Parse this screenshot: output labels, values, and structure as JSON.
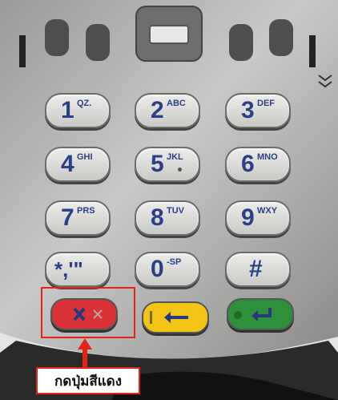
{
  "keys": [
    {
      "digit": "1",
      "sub": "QZ."
    },
    {
      "digit": "2",
      "sub": "ABC"
    },
    {
      "digit": "3",
      "sub": "DEF"
    },
    {
      "digit": "4",
      "sub": "GHI"
    },
    {
      "digit": "5",
      "sub": "JKL"
    },
    {
      "digit": "6",
      "sub": "MNO"
    },
    {
      "digit": "7",
      "sub": "PRS"
    },
    {
      "digit": "8",
      "sub": "TUV"
    },
    {
      "digit": "9",
      "sub": "WXY"
    },
    {
      "digit": "*,'\"",
      "sub": ""
    },
    {
      "digit": "0",
      "sub": "-SP"
    },
    {
      "digit": "#",
      "sub": ""
    }
  ],
  "function_keys": {
    "cancel": {
      "color": "#d9333a",
      "icon": "cancel-x-icon"
    },
    "clear": {
      "color": "#f2c418",
      "icon": "backspace-arrow-icon"
    },
    "enter": {
      "color": "#2f8f3a",
      "icon": "enter-arrow-icon"
    }
  },
  "callout": {
    "label": "กดปุ่มสีแดง",
    "color": "#e2231a"
  }
}
